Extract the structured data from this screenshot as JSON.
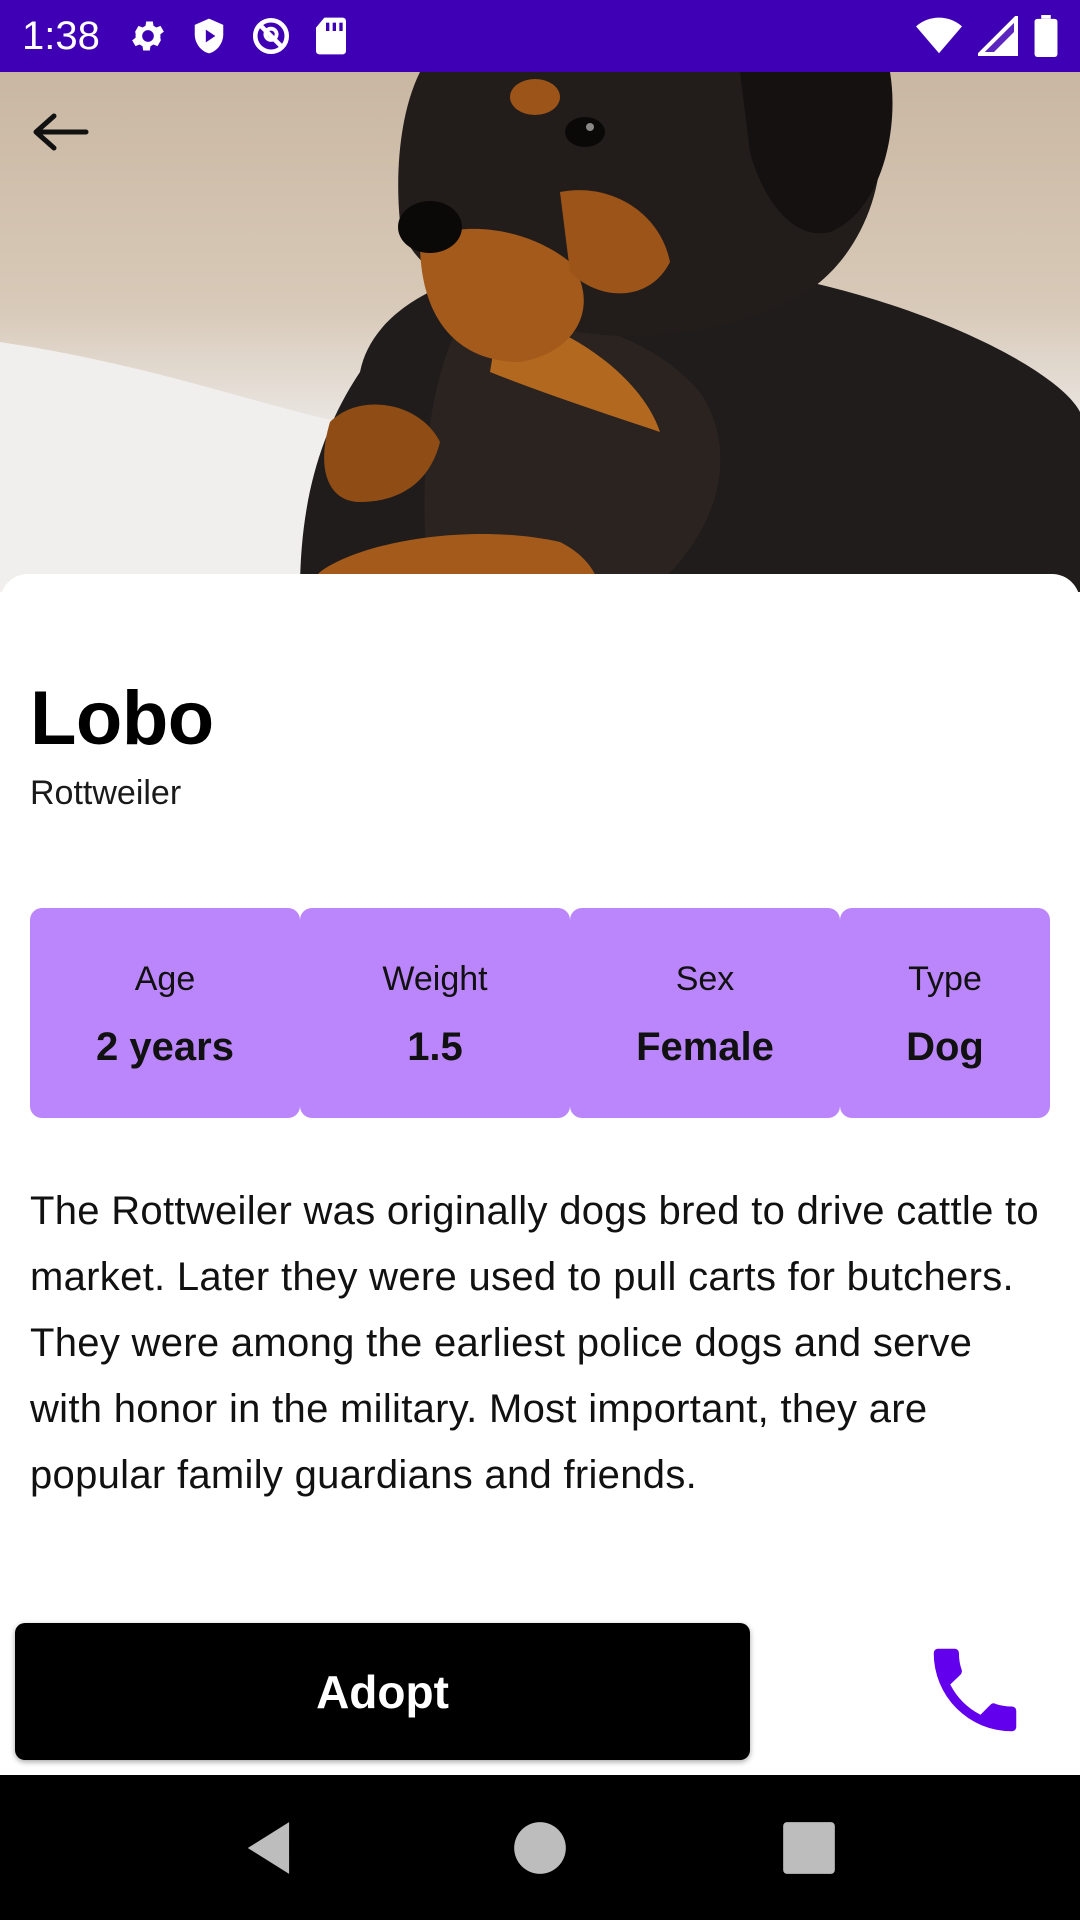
{
  "status_bar": {
    "time": "1:38",
    "icons_left": [
      "settings-icon",
      "play-protect-icon",
      "no-disturb-icon",
      "sd-card-icon"
    ],
    "icons_right": [
      "wifi-icon",
      "signal-icon",
      "battery-icon"
    ],
    "background": "#3f00b5"
  },
  "hero": {
    "image": "rottweiler-puppy-photo",
    "back_icon": "arrow-left-icon"
  },
  "pet": {
    "name": "Lobo",
    "breed": "Rottweiler"
  },
  "stats": [
    {
      "label": "Age",
      "value": "2 years"
    },
    {
      "label": "Weight",
      "value": "1.5"
    },
    {
      "label": "Sex",
      "value": "Female"
    },
    {
      "label": "Type",
      "value": "Dog"
    }
  ],
  "description": "The Rottweiler was originally dogs bred to drive cattle to market. Later they were used to pull carts for butchers. They were among the earliest police dogs and serve with honor in the military. Most important, they are popular family guardians and friends.",
  "actions": {
    "adopt_label": "Adopt",
    "call_icon": "phone-icon"
  },
  "colors": {
    "accent": "#6200ee",
    "stat_background": "#bb86fc",
    "button_background": "#000000"
  }
}
